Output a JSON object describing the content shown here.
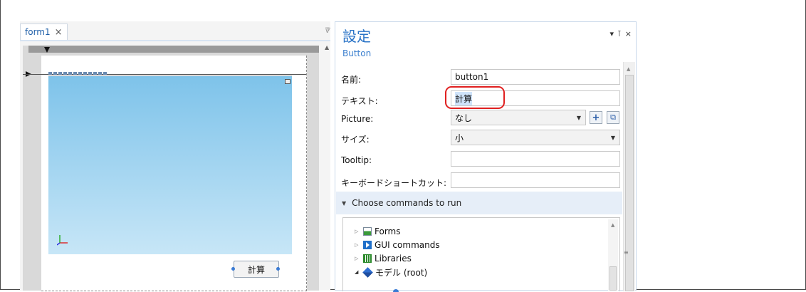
{
  "document": {
    "tab_label": "form1",
    "tab_close": "×",
    "tab_overflow": "▿"
  },
  "form_preview": {
    "button_label": "計算"
  },
  "settings_panel": {
    "title": "設定",
    "subtitle": "Button",
    "controls": {
      "menu": "▾",
      "pin": "⊺",
      "close": "×"
    },
    "rows": [
      {
        "label": "名前:",
        "value": "button1"
      },
      {
        "label": "テキスト:",
        "value": "計算"
      },
      {
        "label": "Picture:",
        "value": "なし"
      },
      {
        "label": "サイズ:",
        "value": "小"
      },
      {
        "label": "Tooltip:",
        "value": ""
      },
      {
        "label": "キーボードショートカット:",
        "value": ""
      }
    ],
    "picture_add_icon": "+",
    "picture_browse_icon": "⧉",
    "section_label": "Choose commands to run",
    "tree": [
      {
        "label": "Forms",
        "icon": "forms-icon"
      },
      {
        "label": "GUI commands",
        "icon": "gui-commands-icon"
      },
      {
        "label": "Libraries",
        "icon": "libraries-icon"
      },
      {
        "label": "モデル (root)",
        "icon": "model-icon"
      }
    ]
  },
  "colors": {
    "accent": "#2b74c7",
    "highlight_ring": "#e02020",
    "section_bg": "#e6eef8"
  }
}
